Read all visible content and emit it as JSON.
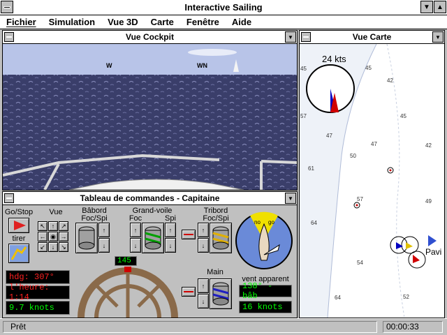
{
  "app": {
    "title": "Interactive Sailing"
  },
  "menu": [
    "Fichier",
    "Simulation",
    "Vue 3D",
    "Carte",
    "Fenêtre",
    "Aide"
  ],
  "cockpit": {
    "title": "Vue Cockpit",
    "markers": [
      "W",
      "W",
      "WN",
      "W"
    ]
  },
  "carte": {
    "title": "Vue Carte",
    "wind_speed": "24 kts",
    "depths": [
      "45",
      "45",
      "42",
      "57",
      "45",
      "47",
      "47",
      "42",
      "50",
      "61",
      "57",
      "64",
      "49",
      "54",
      "52",
      "64"
    ],
    "place_label": "Pavi"
  },
  "panel": {
    "title": "Tableau de commandes  - Capitaine",
    "go_stop": "Go/Stop",
    "tirer": "tirer",
    "vue": "Vue",
    "babord": "Bâbord",
    "babord_sub": "Foc/Spi",
    "grand_voile": "Grand-voile",
    "gv_foc": "Foc",
    "gv_spi": "Spi",
    "tribord": "Tribord",
    "tribord_sub": "Foc/Spi",
    "main": "Main",
    "vent_apparent": "vent apparent",
    "hdg": "hdg:  307°",
    "heure": "l'heure: 1:14",
    "speed": "9.7  knots",
    "heading_box": "145",
    "vent_dir": "138° - bâb",
    "vent_speed": "16  knots",
    "no_go_left": "no",
    "no_go_right": "go"
  },
  "status": {
    "text": "Prêt",
    "time": "00:00:33"
  },
  "colors": {
    "readout_red": "#ff2020",
    "readout_green": "#00ff00",
    "water": "#3a3e6a",
    "sky": "#b8c4e8"
  }
}
